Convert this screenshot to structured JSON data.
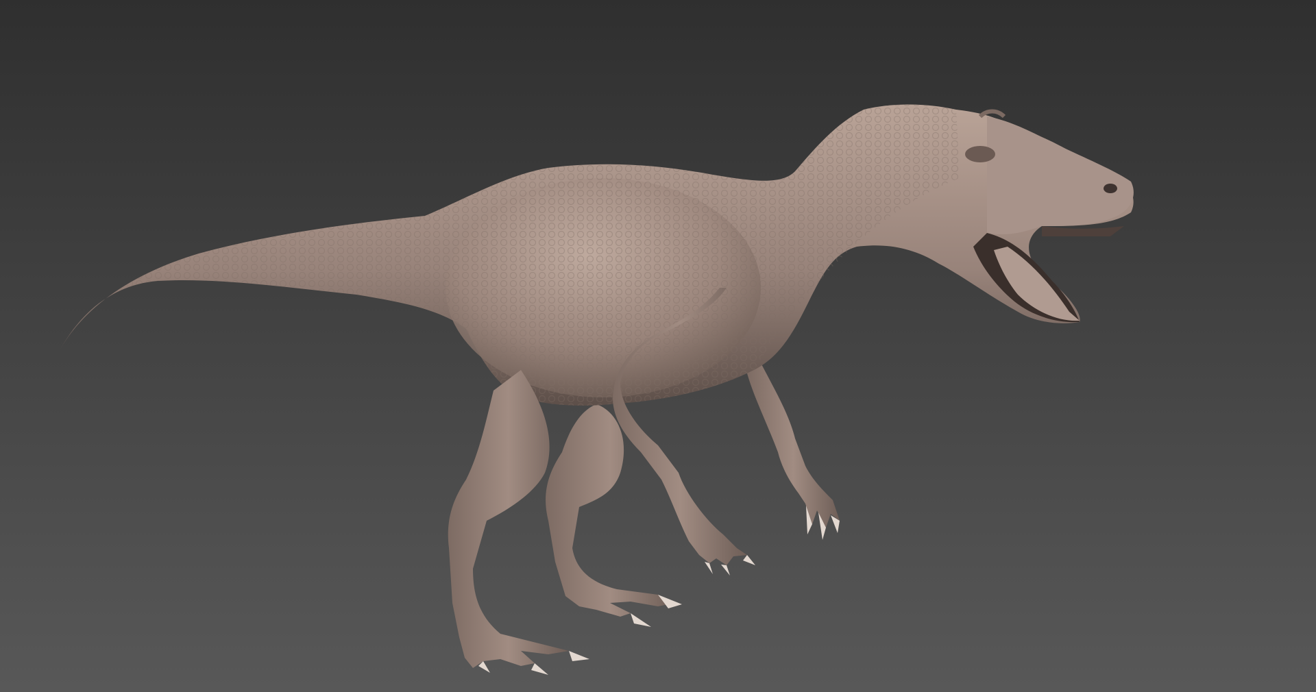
{
  "viewport": {
    "background_top": "#2f2f2f",
    "background_bottom": "#585858",
    "subject": "dinosaur-sculpt"
  },
  "model": {
    "material_light": "#b9a397",
    "material_mid": "#98837a",
    "material_dark": "#5d4f49",
    "claw_color": "#e3d8d0"
  }
}
